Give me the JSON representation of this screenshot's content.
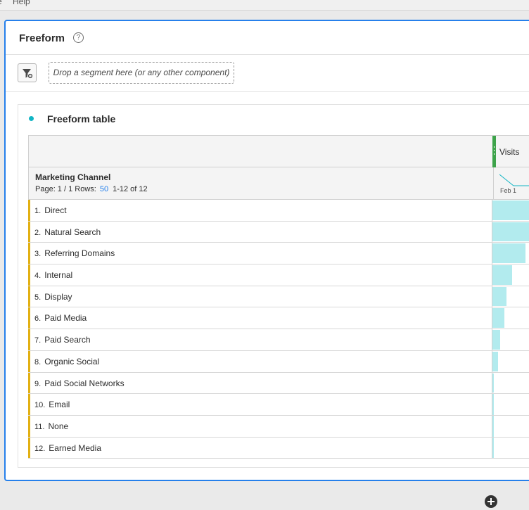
{
  "menubar": {
    "items": [
      "e",
      "Help"
    ]
  },
  "panel": {
    "title": "Freeform",
    "help_glyph": "?"
  },
  "segment_bar": {
    "dropzone_text": "Drop a segment here (or any other component)",
    "filter_icon": "segment-filter-add-icon"
  },
  "visualization": {
    "title": "Freeform table",
    "status_color": "#12b5c4",
    "metric_header": "Visits",
    "dimension_header": "Marketing Channel",
    "paging": {
      "page_label": "Page: 1 / 1",
      "rows_label": "Rows:",
      "rows_value": "50",
      "range": "1-12 of 12"
    },
    "sparkline_label": "Feb 1",
    "bar_color": "#b2ebee",
    "rows": [
      {
        "rank": "1.",
        "name": "Direct",
        "share": 1.0
      },
      {
        "rank": "2.",
        "name": "Natural Search",
        "share": 1.0
      },
      {
        "rank": "3.",
        "name": "Referring Domains",
        "share": 0.66
      },
      {
        "rank": "4.",
        "name": "Internal",
        "share": 0.39
      },
      {
        "rank": "5.",
        "name": "Display",
        "share": 0.28
      },
      {
        "rank": "6.",
        "name": "Paid Media",
        "share": 0.24
      },
      {
        "rank": "7.",
        "name": "Paid Search",
        "share": 0.15
      },
      {
        "rank": "8.",
        "name": "Organic Social",
        "share": 0.11
      },
      {
        "rank": "9.",
        "name": "Paid Social Networks",
        "share": 0.03
      },
      {
        "rank": "10.",
        "name": "Email",
        "share": 0.0
      },
      {
        "rank": "11.",
        "name": "None",
        "share": 0.0
      },
      {
        "rank": "12.",
        "name": "Earned Media",
        "share": 0.0
      }
    ]
  }
}
